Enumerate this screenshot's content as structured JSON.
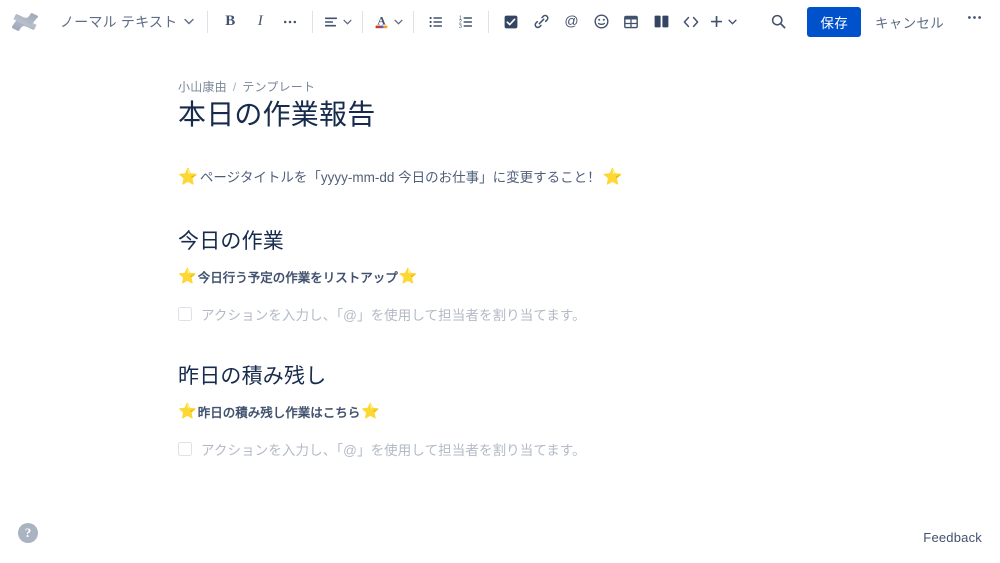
{
  "app": {
    "name": "confluence-editor",
    "logo_icon": "confluence-logo",
    "accent_color": "#0052cc",
    "star_color": "#ffab00",
    "text_color": "#172b4d",
    "muted_color": "#7a869a",
    "placeholder_color": "#b3bac5"
  },
  "toolbar": {
    "style_selector": {
      "label": "ノーマル テキスト",
      "caret_icon": "chevron-down-icon"
    },
    "bold_label": "B",
    "italic_label": "I",
    "more_formatting_label": "•••",
    "align_icon": "text-align-icon",
    "text_color_icon": "text-color-icon",
    "bullet_list_icon": "bullet-list-icon",
    "numbered_list_icon": "numbered-list-icon",
    "task_icon": "action-item-icon",
    "link_icon": "link-icon",
    "mention_icon": "mention-icon",
    "mention_glyph": "@",
    "emoji_icon": "emoji-icon",
    "table_icon": "table-icon",
    "layout_icon": "page-layout-icon",
    "code_icon": "code-block-icon",
    "code_glyph": "<>",
    "insert_icon": "plus-icon",
    "search_icon": "search-icon",
    "save_label": "保存",
    "cancel_label": "キャンセル",
    "more_label": "•••"
  },
  "document": {
    "breadcrumb": {
      "space": "小山康由",
      "separator": "/",
      "parent": "テンプレート"
    },
    "title": "本日の作業報告",
    "star_glyph": "⭐",
    "intro": {
      "text": "ページタイトルを「yyyy-mm-dd 今日のお仕事」に変更すること！"
    },
    "sections": [
      {
        "heading": "今日の作業",
        "hint": "今日行う予定の作業をリストアップ",
        "task_placeholder": "アクションを入力し、「@」を使用して担当者を割り当てます。",
        "task_checked": false
      },
      {
        "heading": "昨日の積み残し",
        "hint": "昨日の積み残し作業はこちら",
        "task_placeholder": "アクションを入力し、「@」を使用して担当者を割り当てます。",
        "task_checked": false
      }
    ]
  },
  "footer": {
    "help_label": "?",
    "help_icon": "question-mark-icon",
    "feedback_label": "Feedback"
  }
}
